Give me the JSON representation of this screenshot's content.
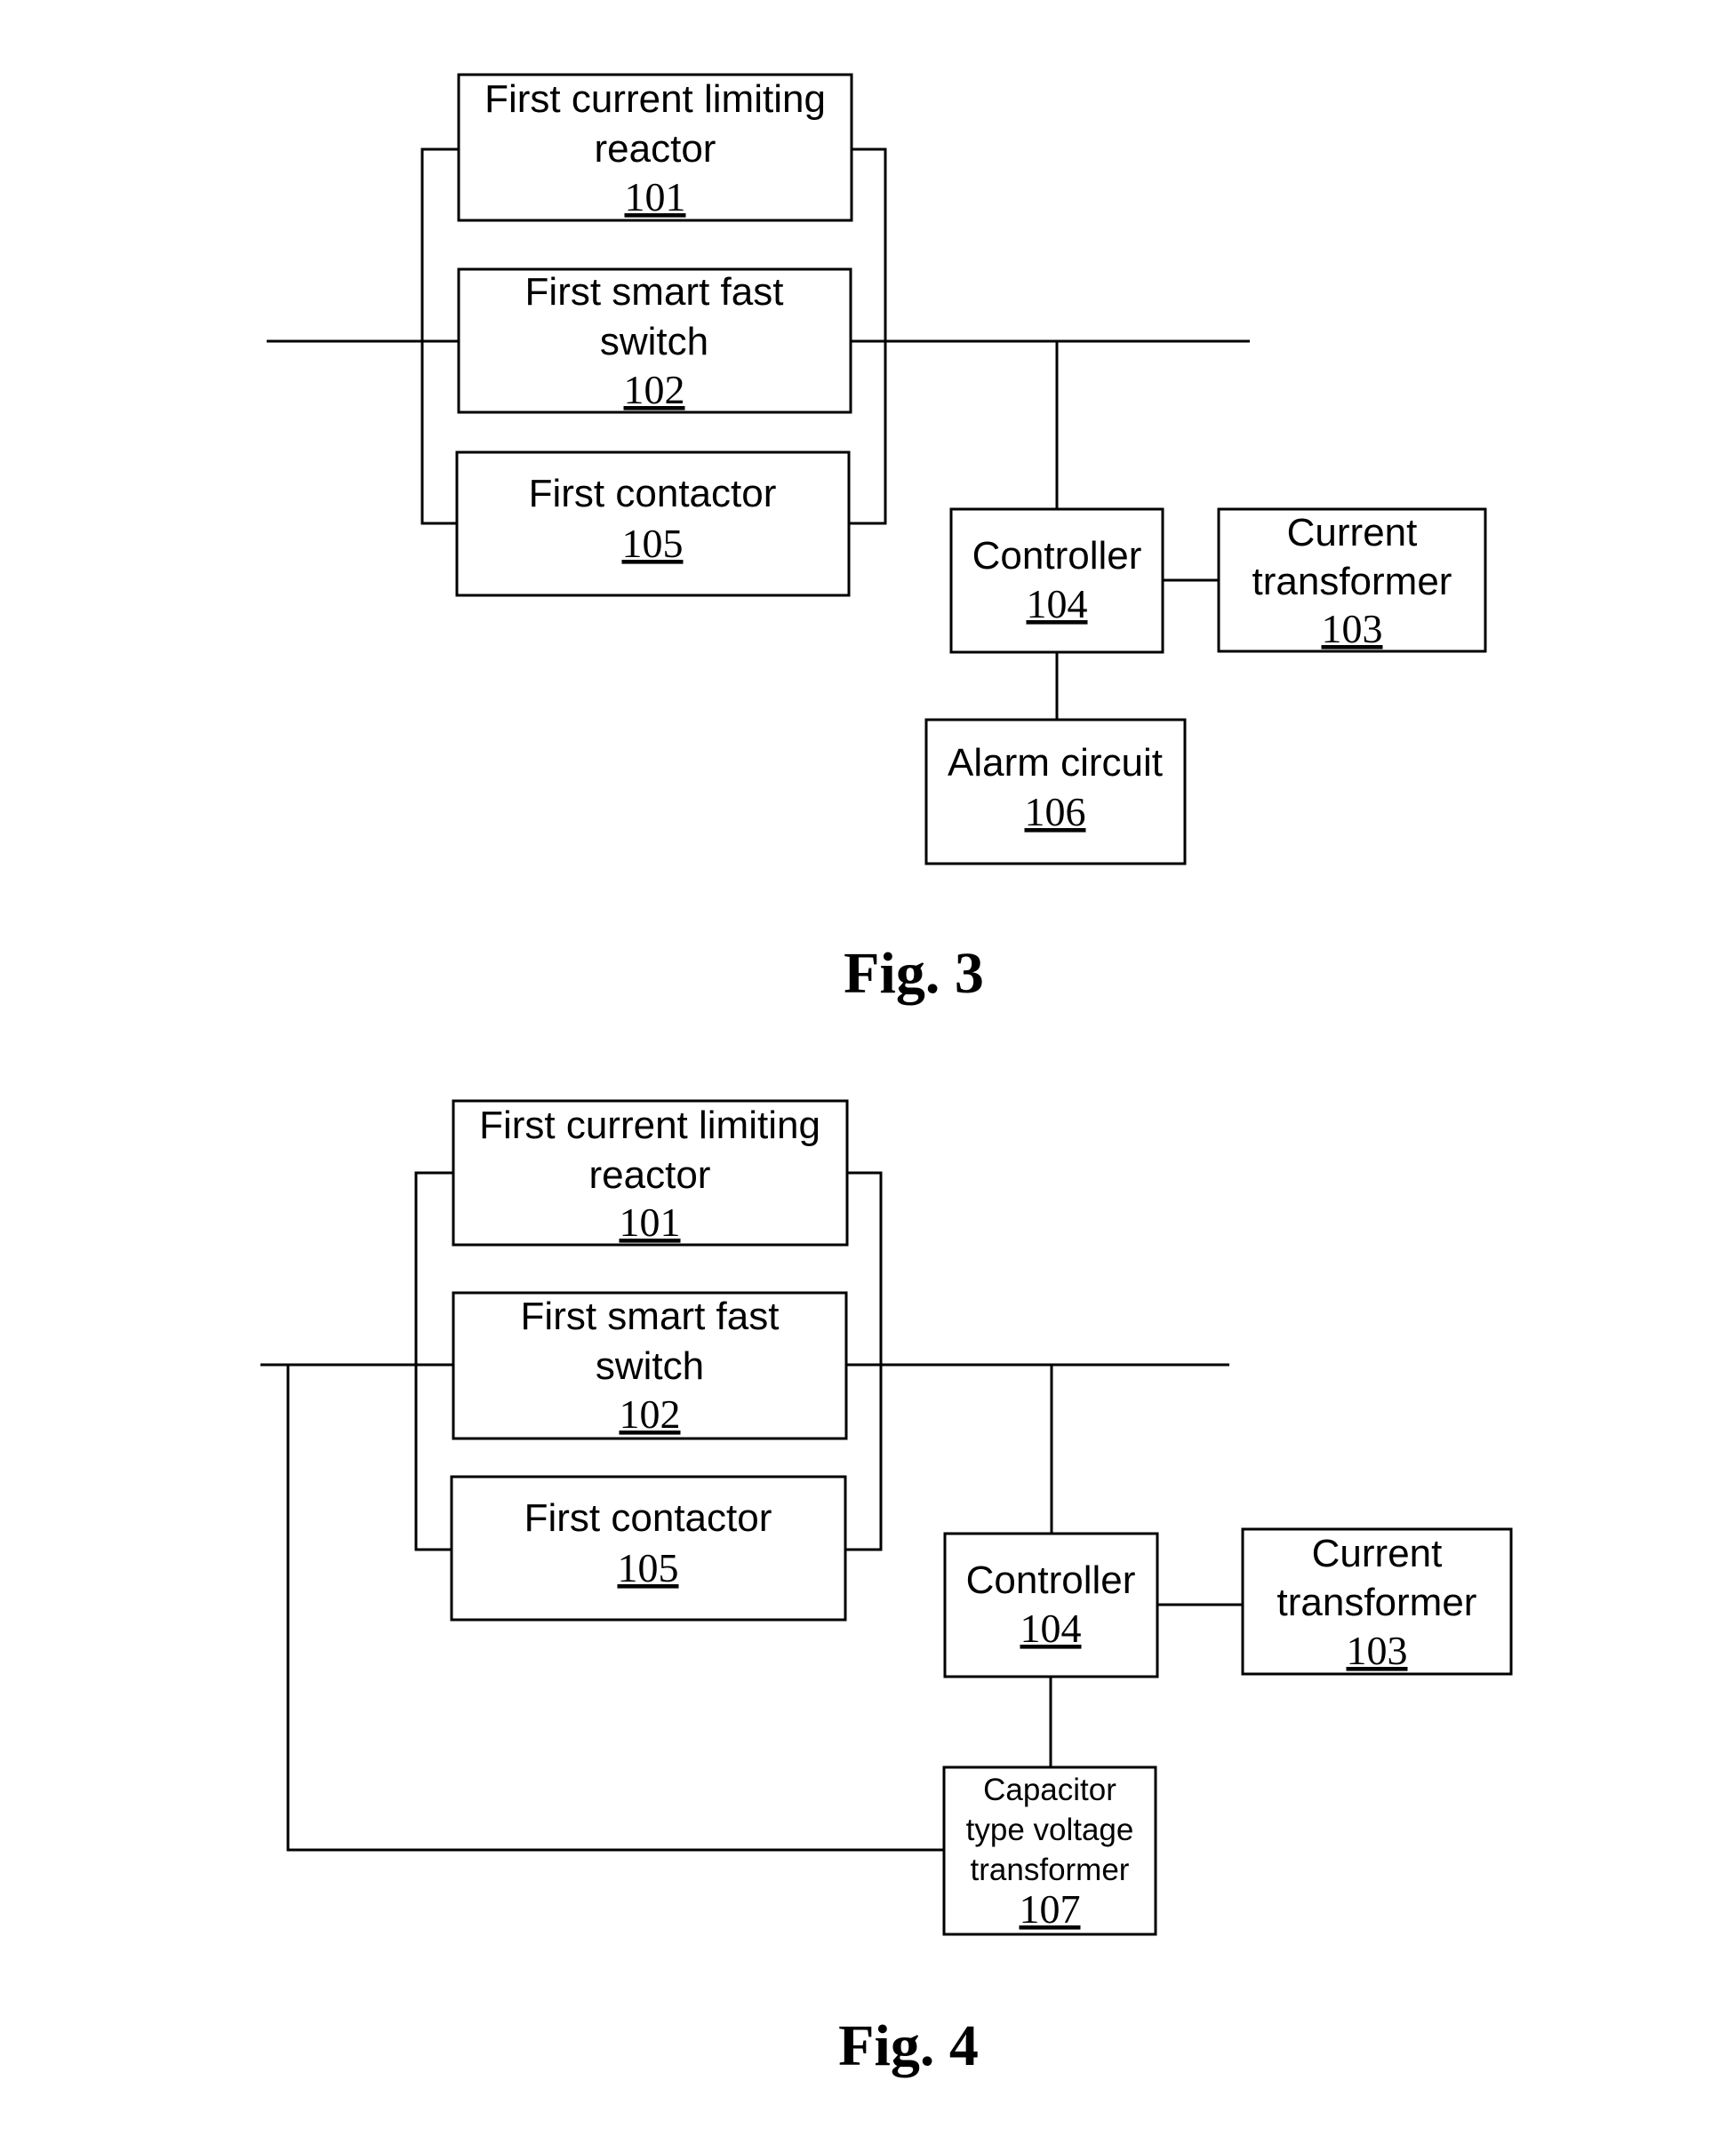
{
  "figures": [
    {
      "caption": "Fig. 3",
      "blocks": {
        "reactor": {
          "lines": [
            "First current limiting",
            "reactor"
          ],
          "ref": "101"
        },
        "switch": {
          "lines": [
            "First smart fast",
            "switch"
          ],
          "ref": "102"
        },
        "contactor": {
          "lines": [
            "First contactor"
          ],
          "ref": "105"
        },
        "controller": {
          "lines": [
            "Controller"
          ],
          "ref": "104"
        },
        "ct": {
          "lines": [
            "Current",
            "transformer"
          ],
          "ref": "103"
        },
        "alarm": {
          "lines": [
            "Alarm circuit"
          ],
          "ref": "106"
        }
      }
    },
    {
      "caption": "Fig. 4",
      "blocks": {
        "reactor": {
          "lines": [
            "First current limiting",
            "reactor"
          ],
          "ref": "101"
        },
        "switch": {
          "lines": [
            "First smart fast",
            "switch"
          ],
          "ref": "102"
        },
        "contactor": {
          "lines": [
            "First contactor"
          ],
          "ref": "105"
        },
        "controller": {
          "lines": [
            "Controller"
          ],
          "ref": "104"
        },
        "ct": {
          "lines": [
            "Current",
            "transformer"
          ],
          "ref": "103"
        },
        "cvt": {
          "lines": [
            "Capacitor",
            "type voltage",
            "transformer"
          ],
          "ref": "107"
        }
      }
    }
  ]
}
